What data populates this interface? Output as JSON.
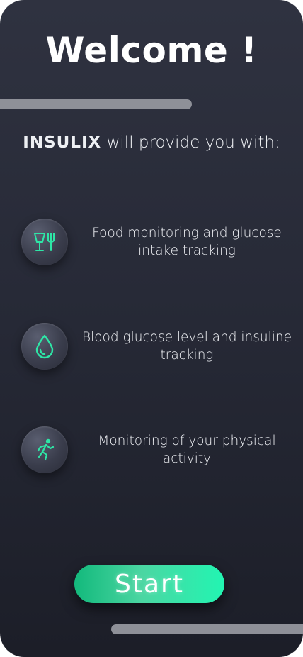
{
  "header": {
    "title": "Welcome !"
  },
  "intro": {
    "brand": "INSULIX",
    "text": " will provide you with:"
  },
  "features": [
    {
      "icon": "food-icon",
      "label": "Food monitoring and glucose intake tracking"
    },
    {
      "icon": "blood-drop-icon",
      "label": "Blood glucose level and insuline tracking"
    },
    {
      "icon": "running-icon",
      "label": "Monitoring of your physical activity"
    }
  ],
  "actions": {
    "start_label": "Start"
  },
  "colors": {
    "accent": "#1fe3a4",
    "icon_glow": "#2ee6a6",
    "background": "#2a2d3a",
    "bar": "#8e9098"
  }
}
